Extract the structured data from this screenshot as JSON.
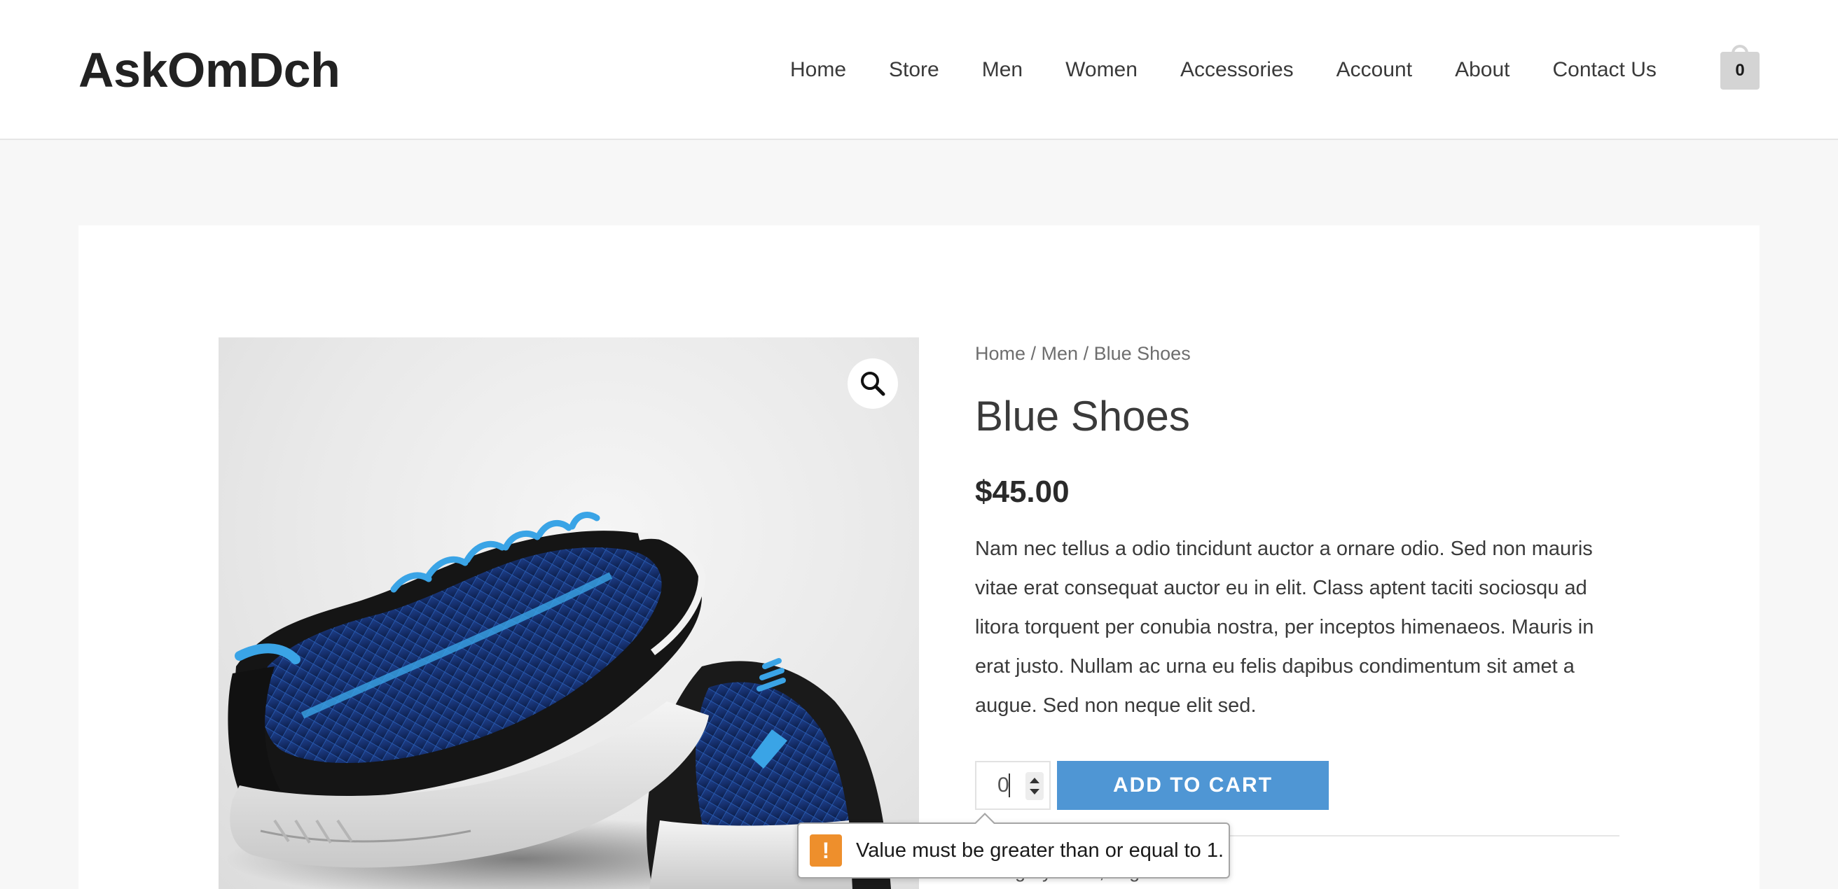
{
  "site": {
    "title": "AskOmDch"
  },
  "nav": {
    "items": [
      {
        "label": "Home"
      },
      {
        "label": "Store"
      },
      {
        "label": "Men"
      },
      {
        "label": "Women"
      },
      {
        "label": "Accessories"
      },
      {
        "label": "Account"
      },
      {
        "label": "About"
      },
      {
        "label": "Contact Us"
      }
    ]
  },
  "cart": {
    "count": "0",
    "icon": "shopping-bag-icon"
  },
  "gallery": {
    "zoom_icon": "magnifier-icon",
    "image": "blue-shoes-photo"
  },
  "breadcrumb": {
    "home": "Home",
    "category": "Men",
    "separator": " / ",
    "current": "Blue Shoes"
  },
  "product": {
    "title": "Blue Shoes",
    "price": "$45.00",
    "description": "Nam nec tellus a odio tincidunt auctor a ornare odio. Sed non mauris vitae erat consequat auctor eu in elit. Class aptent taciti sociosqu ad litora torquent per conubia nostra, per inceptos himenaeos. Mauris in erat justo. Nullam ac urna eu felis dapibus condimentum sit amet a augue. Sed non neque elit sed.",
    "quantity": "0",
    "add_to_cart_label": "ADD TO CART",
    "meta_visible": "Category: Men, Tags: Shoes"
  },
  "validation": {
    "icon": "warning-icon",
    "message": "Value must be greater than or equal to 1."
  },
  "colors": {
    "accent": "#4f96d4",
    "warning": "#ee8f2c",
    "page_background": "#f7f7f7"
  }
}
